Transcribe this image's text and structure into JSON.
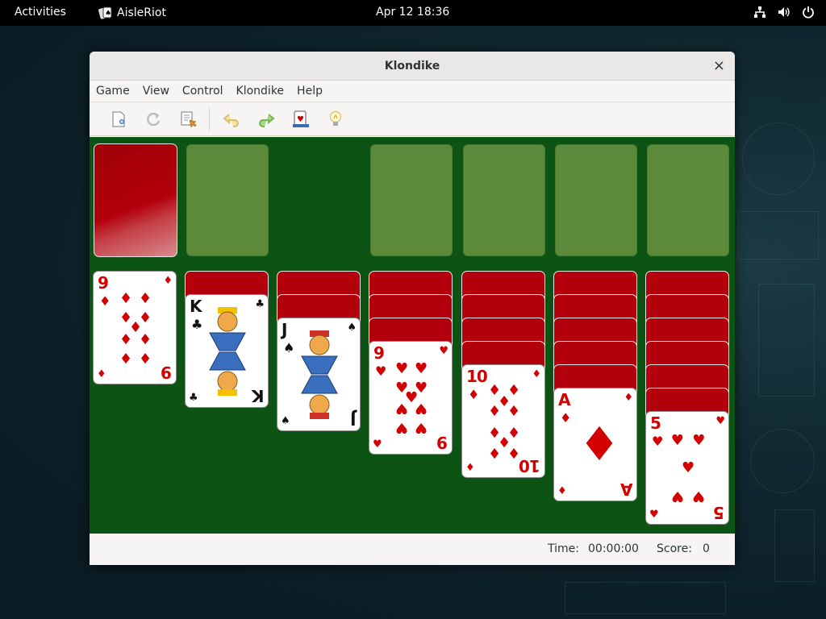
{
  "topbar": {
    "activities": "Activities",
    "app_name": "AisleRiot",
    "clock": "Apr 12  18:36"
  },
  "window": {
    "title": "Klondike",
    "close_glyph": "×"
  },
  "menu": [
    "Game",
    "View",
    "Control",
    "Klondike",
    "Help"
  ],
  "toolbar": {
    "icons": [
      "new-game-icon",
      "restart-icon",
      "select-game-icon",
      "undo-icon",
      "redo-icon",
      "deal-icon",
      "hint-icon"
    ]
  },
  "tableau": [
    {
      "hidden": 0,
      "rank": "9",
      "suit": "♦",
      "color": "red"
    },
    {
      "hidden": 1,
      "rank": "K",
      "suit": "♣",
      "color": "black"
    },
    {
      "hidden": 2,
      "rank": "J",
      "suit": "♠",
      "color": "black"
    },
    {
      "hidden": 3,
      "rank": "9",
      "suit": "♥",
      "color": "red"
    },
    {
      "hidden": 4,
      "rank": "10",
      "suit": "♦",
      "color": "red"
    },
    {
      "hidden": 5,
      "rank": "A",
      "suit": "♦",
      "color": "red"
    },
    {
      "hidden": 6,
      "rank": "5",
      "suit": "♥",
      "color": "red"
    }
  ],
  "status": {
    "time_label": "Time:",
    "time_value": "00:00:00",
    "score_label": "Score:",
    "score_value": "0"
  },
  "colors": {
    "felt": "#0d5313",
    "slot": "#5b8a3b",
    "card_back": "#b2000c",
    "red_suit": "#d20000"
  }
}
